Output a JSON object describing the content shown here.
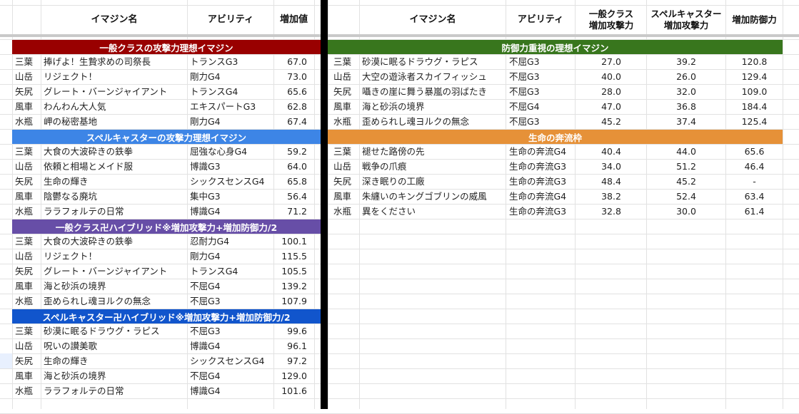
{
  "headers": {
    "left": {
      "name": "イマジン名",
      "ability": "アビリティ",
      "value": "増加値"
    },
    "right": {
      "name": "イマジン名",
      "ability": "アビリティ",
      "general_line1": "一般クラス",
      "general_line2": "増加攻撃力",
      "spell_line1": "スペルキャスター",
      "spell_line2": "増加攻撃力",
      "defense": "増加防御力"
    }
  },
  "left_sections": [
    {
      "title": "一般クラスの攻撃力理想イマジン",
      "color": "#990000",
      "rows": [
        {
          "sign": "三葉",
          "name": "捧げよ！生贄求めの司祭長",
          "ability": "トランスG3",
          "value": "67.0"
        },
        {
          "sign": "山岳",
          "name": "リジェクト！",
          "ability": "剛力G4",
          "value": "73.0"
        },
        {
          "sign": "矢尻",
          "name": "グレート・バーンジャイアント",
          "ability": "トランスG4",
          "value": "65.6"
        },
        {
          "sign": "風車",
          "name": "わんわん大人気",
          "ability": "エキスパートG3",
          "value": "62.8"
        },
        {
          "sign": "水瓶",
          "name": "岬の秘密基地",
          "ability": "剛力G4",
          "value": "67.4"
        }
      ]
    },
    {
      "title": "スペルキャスターの攻撃力理想イマジン",
      "color": "#3d85e6",
      "rows": [
        {
          "sign": "三葉",
          "name": "大食の大波砕きの鉄拳",
          "ability": "屈強な心身G4",
          "value": "59.2"
        },
        {
          "sign": "山岳",
          "name": "依頼と相場とメイド服",
          "ability": "博識G3",
          "value": "64.0"
        },
        {
          "sign": "矢尻",
          "name": "生命の輝き",
          "ability": "シックスセンスG4",
          "value": "65.8"
        },
        {
          "sign": "風車",
          "name": "陰鬱なる廃坑",
          "ability": "集中G3",
          "value": "56.4"
        },
        {
          "sign": "水瓶",
          "name": "ララフォルテの日常",
          "ability": "博識G4",
          "value": "71.2"
        }
      ]
    },
    {
      "title": "一般クラス卍ハイブリッド※増加攻撃力+増加防御力/2",
      "color": "#674ea7",
      "rows": [
        {
          "sign": "三葉",
          "name": "大食の大波砕きの鉄拳",
          "ability": "忍耐力G4",
          "value": "100.1"
        },
        {
          "sign": "山岳",
          "name": "リジェクト！",
          "ability": "剛力G4",
          "value": "115.5"
        },
        {
          "sign": "矢尻",
          "name": "グレート・バーンジャイアント",
          "ability": "トランスG4",
          "value": "105.5"
        },
        {
          "sign": "風車",
          "name": "海と砂浜の境界",
          "ability": "不屈G4",
          "value": "139.2"
        },
        {
          "sign": "水瓶",
          "name": "歪められし魂ヨルクの無念",
          "ability": "不屈G3",
          "value": "107.9"
        }
      ]
    },
    {
      "title": "スペルキャスター卍ハイブリッド※増加攻撃力+増加防御力/2",
      "color": "#1155cc",
      "rows": [
        {
          "sign": "三葉",
          "name": "砂漠に眠るドラウグ・ラピス",
          "ability": "不屈G3",
          "value": "99.6"
        },
        {
          "sign": "山岳",
          "name": "呪いの讃美歌",
          "ability": "博識G4",
          "value": "96.1"
        },
        {
          "sign": "矢尻",
          "name": "生命の輝き",
          "ability": "シックスセンスG4",
          "value": "97.2"
        },
        {
          "sign": "風車",
          "name": "海と砂浜の境界",
          "ability": "不屈G4",
          "value": "129.0"
        },
        {
          "sign": "水瓶",
          "name": "ララフォルテの日常",
          "ability": "博識G4",
          "value": "101.6"
        }
      ]
    }
  ],
  "right_sections": [
    {
      "title": "防御力重視の理想イマジン",
      "color": "#38761d",
      "rows": [
        {
          "sign": "三葉",
          "name": "砂漠に眠るドラウグ・ラピス",
          "ability": "不屈G3",
          "general": "27.0",
          "spell": "39.2",
          "defense": "120.8"
        },
        {
          "sign": "山岳",
          "name": "大空の遊泳者スカイフィッシュ",
          "ability": "不屈G3",
          "general": "40.0",
          "spell": "26.0",
          "defense": "129.4"
        },
        {
          "sign": "矢尻",
          "name": "囁きの崖に舞う暴嵐の羽ばたき",
          "ability": "不屈G3",
          "general": "28.0",
          "spell": "32.0",
          "defense": "109.0"
        },
        {
          "sign": "風車",
          "name": "海と砂浜の境界",
          "ability": "不屈G4",
          "general": "47.0",
          "spell": "36.8",
          "defense": "184.4"
        },
        {
          "sign": "水瓶",
          "name": "歪められし魂ヨルクの無念",
          "ability": "不屈G3",
          "general": "45.2",
          "spell": "37.4",
          "defense": "125.4"
        }
      ]
    },
    {
      "title": "生命の奔流枠",
      "color": "#e69138",
      "rows": [
        {
          "sign": "三葉",
          "name": "褪せた路傍の先",
          "ability": "生命の奔流G4",
          "general": "40.4",
          "spell": "44.0",
          "defense": "65.6"
        },
        {
          "sign": "山岳",
          "name": "戦争の爪痕",
          "ability": "生命の奔流G3",
          "general": "34.0",
          "spell": "51.2",
          "defense": "46.4"
        },
        {
          "sign": "矢尻",
          "name": "深き眠りの工廠",
          "ability": "生命の奔流G3",
          "general": "48.4",
          "spell": "45.2",
          "defense": "-"
        },
        {
          "sign": "風車",
          "name": "朱纏いのキングゴブリンの威風",
          "ability": "生命の奔流G4",
          "general": "38.2",
          "spell": "52.4",
          "defense": "63.4"
        },
        {
          "sign": "水瓶",
          "name": "異をください",
          "ability": "生命の奔流G3",
          "general": "32.8",
          "spell": "30.0",
          "defense": "61.4"
        }
      ]
    }
  ]
}
